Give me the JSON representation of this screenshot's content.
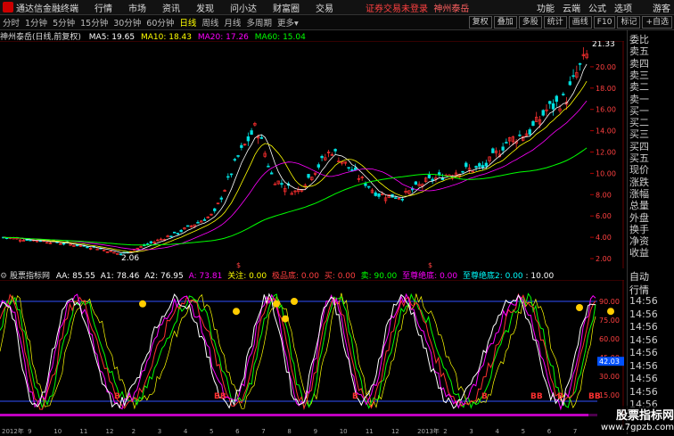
{
  "titlebar": {
    "app_name": "通达信金融终端",
    "menus": [
      "行情",
      "市场",
      "资讯",
      "发现",
      "问小达",
      "财富圈",
      "交易"
    ],
    "status": "证券交易未登录",
    "stock_name": "神州泰岳",
    "right_menus": [
      "功能",
      "云端",
      "公式",
      "选项",
      "游客"
    ]
  },
  "toolbar": {
    "timeframes": [
      "分时",
      "1分钟",
      "5分钟",
      "15分钟",
      "30分钟",
      "60分钟",
      "日线",
      "周线",
      "月线",
      "多周期",
      "更多"
    ],
    "active": "日线",
    "right_buttons": [
      "复权",
      "叠加",
      "多股",
      "统计",
      "画线",
      "F10",
      "标记",
      "+自选"
    ]
  },
  "info": {
    "title": "神州泰岳(日线,前复权)",
    "ma5": "MA5: 19.65",
    "ma10": "MA10: 18.43",
    "ma20": "MA20: 17.26",
    "ma60": "MA60: 15.04"
  },
  "price_axis": [
    "20.00",
    "18.00",
    "16.00",
    "14.00",
    "12.00",
    "10.00",
    "8.00",
    "6.00",
    "4.00",
    "2.00"
  ],
  "annotations": {
    "high": "21.33",
    "low": "2.06"
  },
  "indicator": {
    "name": "股票指标网",
    "aa": "AA: 85.55",
    "a1": "A1: 78.46",
    "a2": "A2: 76.95",
    "a": "A: 73.81",
    "guanzhu": "关注: 0.00",
    "jipinji": "极品底: 0.00",
    "mai": "买: 0.00",
    "mai2": "卖: 90.00",
    "zhizun": "至尊绝底: 0.00",
    "zhizun2": "至尊绝底2: 0.00",
    "ten": ": 10.00",
    "axis": [
      "90.00",
      "75.00",
      "60.00",
      "45.00",
      "30.00",
      "15.00"
    ],
    "current": "42.03"
  },
  "time_axis": [
    "2012年",
    "9",
    "10",
    "11",
    "12",
    "2",
    "3",
    "4",
    "5",
    "6",
    "7",
    "8",
    "9",
    "10",
    "11",
    "12",
    "2013年",
    "2",
    "3",
    "4",
    "5",
    "6",
    "7"
  ],
  "sidebar": {
    "items": [
      "委比",
      "卖五",
      "卖四",
      "卖三",
      "卖二",
      "卖一",
      "买一",
      "买二",
      "买三",
      "买四",
      "买五",
      "现价",
      "涨跌",
      "涨幅",
      "总量",
      "外盘",
      "换手",
      "净资",
      "收益"
    ],
    "bottom": [
      "自动",
      "行情",
      "14:56",
      "14:56",
      "14:56",
      "14:56",
      "14:56",
      "14:56",
      "14:56",
      "14:56",
      "14:56"
    ]
  },
  "watermark": {
    "line1": "股票指标网",
    "line2": "www.7gpzb.com"
  },
  "colors": {
    "up": "#ff3030",
    "down": "#00e0e0",
    "ma5": "#ffffff",
    "ma10": "#ffff00",
    "ma20": "#ff00ff",
    "ma60": "#00ff00"
  }
}
